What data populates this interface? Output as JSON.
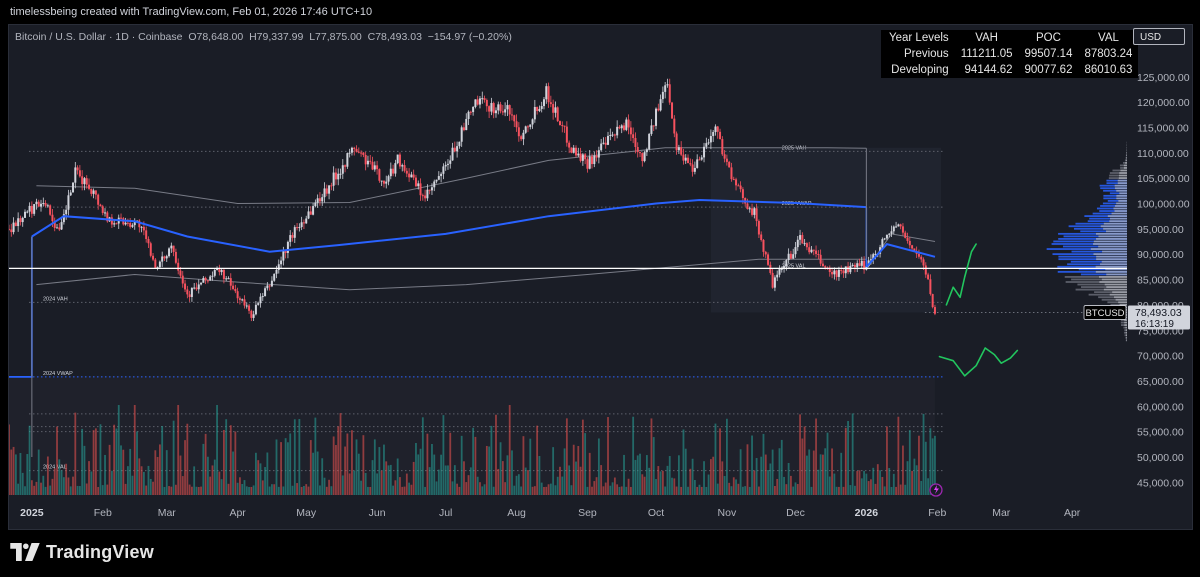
{
  "header": {
    "text": "timelessbeing created with TradingView.com, Feb 01, 2026 17:46 UTC+10"
  },
  "legend": {
    "symbol": "Bitcoin / U.S. Dollar · 1D · Coinbase",
    "open": "O78,648.00",
    "high": "H79,337.99",
    "low": "L77,875.00",
    "close": "C78,493.03",
    "change": "−154.97 (−0.20%)"
  },
  "levels_table": {
    "headers": [
      "Year Levels",
      "VAH",
      "POC",
      "VAL"
    ],
    "rows": [
      [
        "Previous",
        "111211.05",
        "99507.14",
        "87803.24"
      ],
      [
        "Developing",
        "94144.62",
        "90077.62",
        "86010.63"
      ]
    ]
  },
  "currency": "USD",
  "price_tag": {
    "symbol": "BTCUSD",
    "price": "78,493.03",
    "countdown": "16:13:19"
  },
  "level_labels": {
    "vah_2025": "2025 VAH",
    "vwap_2025": "2025 VWAP",
    "val_2025": "2025 VAL",
    "vah_2024": "2024 VAH",
    "vwap_2024": "2024 VWAP",
    "val_2024": "2024 VAL"
  },
  "footer": {
    "brand": "TradingView"
  },
  "colors": {
    "background": "#1a1d26",
    "up": "#d1d4dc",
    "down": "#f7525f",
    "vwap": "#2962ff",
    "horizontal_line": "#ffffff",
    "annotation": "#22c55e",
    "vol_up": "#26a69a",
    "vol_down": "#ef5350"
  },
  "chart_data": {
    "type": "candlestick",
    "y_axis": {
      "min": 45000,
      "max": 125000,
      "step": 5000,
      "tick_labels": [
        "45,000.00",
        "50,000.00",
        "55,000.00",
        "60,000.00",
        "65,000.00",
        "70,000.00",
        "75,000.00",
        "80,000.00",
        "85,000.00",
        "90,000.00",
        "95,000.00",
        "100,000.00",
        "105,000.00",
        "110,000.00",
        "115,000.00",
        "120,000.00",
        "125,000.00"
      ]
    },
    "x_axis": {
      "tick_labels": [
        "2025",
        "Feb",
        "Mar",
        "Apr",
        "May",
        "Jun",
        "Jul",
        "Aug",
        "Sep",
        "Oct",
        "Nov",
        "Dec",
        "2026",
        "Feb",
        "Mar",
        "Apr"
      ],
      "tick_dates": [
        "2025-01-01",
        "2025-02-01",
        "2025-03-01",
        "2025-04-01",
        "2025-05-01",
        "2025-06-01",
        "2025-07-01",
        "2025-08-01",
        "2025-09-01",
        "2025-10-01",
        "2025-11-01",
        "2025-12-01",
        "2026-01-01",
        "2026-02-01",
        "2026-03-01",
        "2026-04-01"
      ],
      "range": [
        "2024-12-22",
        "2026-04-25"
      ]
    },
    "price_path": [
      [
        "2024-12-22",
        95000
      ],
      [
        "2025-01-06",
        101000
      ],
      [
        "2025-01-13",
        94000
      ],
      [
        "2025-01-20",
        106000
      ],
      [
        "2025-01-27",
        103000
      ],
      [
        "2025-02-03",
        97000
      ],
      [
        "2025-02-17",
        96000
      ],
      [
        "2025-02-25",
        87000
      ],
      [
        "2025-03-03",
        92000
      ],
      [
        "2025-03-10",
        82000
      ],
      [
        "2025-03-24",
        87000
      ],
      [
        "2025-04-07",
        78000
      ],
      [
        "2025-04-15",
        84000
      ],
      [
        "2025-04-25",
        94000
      ],
      [
        "2025-05-10",
        103000
      ],
      [
        "2025-05-22",
        111000
      ],
      [
        "2025-06-05",
        104000
      ],
      [
        "2025-06-10",
        109000
      ],
      [
        "2025-06-22",
        101000
      ],
      [
        "2025-07-01",
        107000
      ],
      [
        "2025-07-14",
        120000
      ],
      [
        "2025-07-30",
        118000
      ],
      [
        "2025-08-02",
        113000
      ],
      [
        "2025-08-14",
        122000
      ],
      [
        "2025-08-25",
        111000
      ],
      [
        "2025-09-01",
        108000
      ],
      [
        "2025-09-18",
        116000
      ],
      [
        "2025-09-25",
        109000
      ],
      [
        "2025-10-06",
        124500
      ],
      [
        "2025-10-10",
        111000
      ],
      [
        "2025-10-17",
        107000
      ],
      [
        "2025-10-27",
        115000
      ],
      [
        "2025-11-04",
        104000
      ],
      [
        "2025-11-13",
        98000
      ],
      [
        "2025-11-21",
        84000
      ],
      [
        "2025-12-03",
        93000
      ],
      [
        "2025-12-17",
        86000
      ],
      [
        "2026-01-01",
        88000
      ],
      [
        "2026-01-14",
        96000
      ],
      [
        "2026-01-26",
        88000
      ],
      [
        "2026-01-31",
        78493
      ]
    ],
    "ohlc_last": {
      "open": 78648.0,
      "high": 79337.99,
      "low": 77875.0,
      "close": 78493.03
    },
    "vwap_2025": [
      [
        "2025-01-01",
        93500
      ],
      [
        "2025-01-15",
        97500
      ],
      [
        "2025-02-15",
        96500
      ],
      [
        "2025-03-10",
        93500
      ],
      [
        "2025-04-15",
        90500
      ],
      [
        "2025-05-15",
        91800
      ],
      [
        "2025-07-01",
        94000
      ],
      [
        "2025-08-15",
        97500
      ],
      [
        "2025-10-01",
        100000
      ],
      [
        "2025-10-20",
        100700
      ],
      [
        "2025-12-01",
        100100
      ],
      [
        "2026-01-01",
        99300
      ]
    ],
    "vwap_2026": [
      [
        "2026-01-01",
        87500
      ],
      [
        "2026-01-10",
        92000
      ],
      [
        "2026-01-31",
        89500
      ]
    ],
    "value_area_2025": {
      "upper_end": 111000,
      "lower_start": 78500,
      "lower_end": 88500
    },
    "horizontal_level": 87200,
    "levels_2024": {
      "vah": 80500,
      "vwap": 65800,
      "val": 47300
    },
    "levels_2025": {
      "vah": 110300,
      "vwap": 99300,
      "val": 87803
    },
    "current_price": 78493.03
  }
}
